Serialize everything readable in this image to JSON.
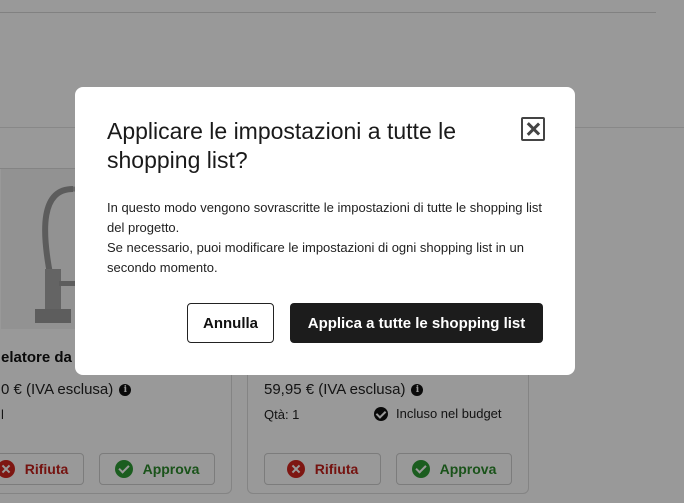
{
  "background": {
    "cards": [
      {
        "name": "elatore da",
        "price": "0 € (IVA esclusa)",
        "qty": "l",
        "budget": "",
        "reject_label": "Rifiuta",
        "approve_label": "Approva"
      },
      {
        "name": "",
        "price": "59,95 € (IVA esclusa)",
        "qty": "Qtà: 1",
        "budget": "Incluso nel budget",
        "reject_label": "Rifiuta",
        "approve_label": "Approva"
      }
    ]
  },
  "modal": {
    "title": "Applicare le impostazioni a tutte le shopping list?",
    "body_line1": "In questo modo vengono sovrascritte le impostazioni di tutte le shopping list del progetto.",
    "body_line2": "Se necessario, puoi modificare le impostazioni di ogni shopping list in un secondo momento.",
    "cancel_label": "Annulla",
    "apply_label": "Applica a tutte le shopping list"
  },
  "colors": {
    "overlay": "#000000",
    "primary_button": "#1c1c1c",
    "reject": "#d2261f",
    "approve": "#2e9b35"
  },
  "icons": [
    "close-icon",
    "info-icon",
    "check-circle-icon",
    "reject-icon",
    "approve-icon",
    "faucet-image"
  ]
}
